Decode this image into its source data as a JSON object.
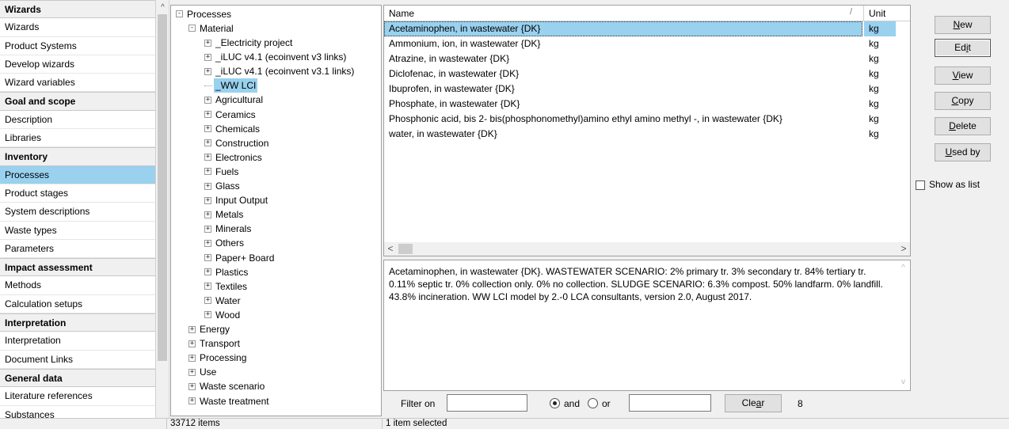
{
  "nav": {
    "items": [
      {
        "type": "category",
        "label": "Wizards"
      },
      {
        "type": "item",
        "label": "Wizards"
      },
      {
        "type": "item",
        "label": "Product Systems"
      },
      {
        "type": "item",
        "label": "Develop wizards"
      },
      {
        "type": "item",
        "label": "Wizard variables"
      },
      {
        "type": "category",
        "label": "Goal and scope"
      },
      {
        "type": "item",
        "label": "Description"
      },
      {
        "type": "item",
        "label": "Libraries"
      },
      {
        "type": "category",
        "label": "Inventory"
      },
      {
        "type": "item",
        "label": "Processes",
        "selected": true
      },
      {
        "type": "item",
        "label": "Product stages"
      },
      {
        "type": "item",
        "label": "System descriptions"
      },
      {
        "type": "item",
        "label": "Waste types"
      },
      {
        "type": "item",
        "label": "Parameters"
      },
      {
        "type": "category",
        "label": "Impact assessment"
      },
      {
        "type": "item",
        "label": "Methods"
      },
      {
        "type": "item",
        "label": "Calculation setups"
      },
      {
        "type": "category",
        "label": "Interpretation"
      },
      {
        "type": "item",
        "label": "Interpretation"
      },
      {
        "type": "item",
        "label": "Document Links"
      },
      {
        "type": "category",
        "label": "General data"
      },
      {
        "type": "item",
        "label": "Literature references"
      },
      {
        "type": "item",
        "label": "Substances"
      }
    ]
  },
  "tree": {
    "nodes": [
      {
        "label": "Processes",
        "depth": 0,
        "expander": "minus"
      },
      {
        "label": "Material",
        "depth": 1,
        "expander": "minus"
      },
      {
        "label": "_Electricity project",
        "depth": 2,
        "expander": "plus"
      },
      {
        "label": "_iLUC v4.1 (ecoinvent v3 links)",
        "depth": 2,
        "expander": "plus"
      },
      {
        "label": "_iLUC v4.1 (ecoinvent v3.1 links)",
        "depth": 2,
        "expander": "plus"
      },
      {
        "label": "_WW LCI",
        "depth": 2,
        "expander": "none",
        "selected": true
      },
      {
        "label": "Agricultural",
        "depth": 2,
        "expander": "plus"
      },
      {
        "label": "Ceramics",
        "depth": 2,
        "expander": "plus"
      },
      {
        "label": "Chemicals",
        "depth": 2,
        "expander": "plus"
      },
      {
        "label": "Construction",
        "depth": 2,
        "expander": "plus"
      },
      {
        "label": "Electronics",
        "depth": 2,
        "expander": "plus"
      },
      {
        "label": "Fuels",
        "depth": 2,
        "expander": "plus"
      },
      {
        "label": "Glass",
        "depth": 2,
        "expander": "plus"
      },
      {
        "label": "Input Output",
        "depth": 2,
        "expander": "plus"
      },
      {
        "label": "Metals",
        "depth": 2,
        "expander": "plus"
      },
      {
        "label": "Minerals",
        "depth": 2,
        "expander": "plus"
      },
      {
        "label": "Others",
        "depth": 2,
        "expander": "plus"
      },
      {
        "label": "Paper+ Board",
        "depth": 2,
        "expander": "plus"
      },
      {
        "label": "Plastics",
        "depth": 2,
        "expander": "plus"
      },
      {
        "label": "Textiles",
        "depth": 2,
        "expander": "plus"
      },
      {
        "label": "Water",
        "depth": 2,
        "expander": "plus"
      },
      {
        "label": "Wood",
        "depth": 2,
        "expander": "plus"
      },
      {
        "label": "Energy",
        "depth": 1,
        "expander": "plus"
      },
      {
        "label": "Transport",
        "depth": 1,
        "expander": "plus"
      },
      {
        "label": "Processing",
        "depth": 1,
        "expander": "plus"
      },
      {
        "label": "Use",
        "depth": 1,
        "expander": "plus"
      },
      {
        "label": "Waste scenario",
        "depth": 1,
        "expander": "plus"
      },
      {
        "label": "Waste treatment",
        "depth": 1,
        "expander": "plus"
      }
    ]
  },
  "grid": {
    "columns": {
      "name": "Name",
      "unit": "Unit"
    },
    "sort_indicator": "/",
    "rows": [
      {
        "name": "Acetaminophen, in wastewater {DK}",
        "unit": "kg",
        "selected": true
      },
      {
        "name": "Ammonium, ion, in wastewater {DK}",
        "unit": "kg"
      },
      {
        "name": "Atrazine, in wastewater {DK}",
        "unit": "kg"
      },
      {
        "name": "Diclofenac, in wastewater {DK}",
        "unit": "kg"
      },
      {
        "name": "Ibuprofen, in wastewater {DK}",
        "unit": "kg"
      },
      {
        "name": "Phosphate, in wastewater {DK}",
        "unit": "kg"
      },
      {
        "name": "Phosphonic acid, bis 2- bis(phosphonomethyl)amino ethyl amino methyl -, in wastewater {DK}",
        "unit": "kg"
      },
      {
        "name": "water, in wastewater {DK}",
        "unit": "kg"
      }
    ]
  },
  "description": {
    "text": "Acetaminophen, in wastewater {DK}. WASTEWATER SCENARIO: 2% primary tr. 3% secondary tr. 84% tertiary tr. 0.11% septic tr. 0% collection only. 0% no collection. SLUDGE SCENARIO: 6.3% compost. 50% landfarm. 0% landfill. 43.8% incineration. WW LCI model by 2.-0 LCA consultants, version 2.0, August 2017."
  },
  "filter": {
    "label": "Filter on",
    "input1_value": "",
    "and_label": "and",
    "or_label": "or",
    "and_checked": true,
    "input2_value": "",
    "clear_label": "Clear",
    "count": "8"
  },
  "actions": {
    "new_label": "New",
    "edit_label": "Edit",
    "view_label": "View",
    "copy_label": "Copy",
    "delete_label": "Delete",
    "used_by_label": "Used by",
    "show_as_list_label": "Show as list"
  },
  "status": {
    "items_count": "33712 items",
    "selection": "1 item selected"
  }
}
